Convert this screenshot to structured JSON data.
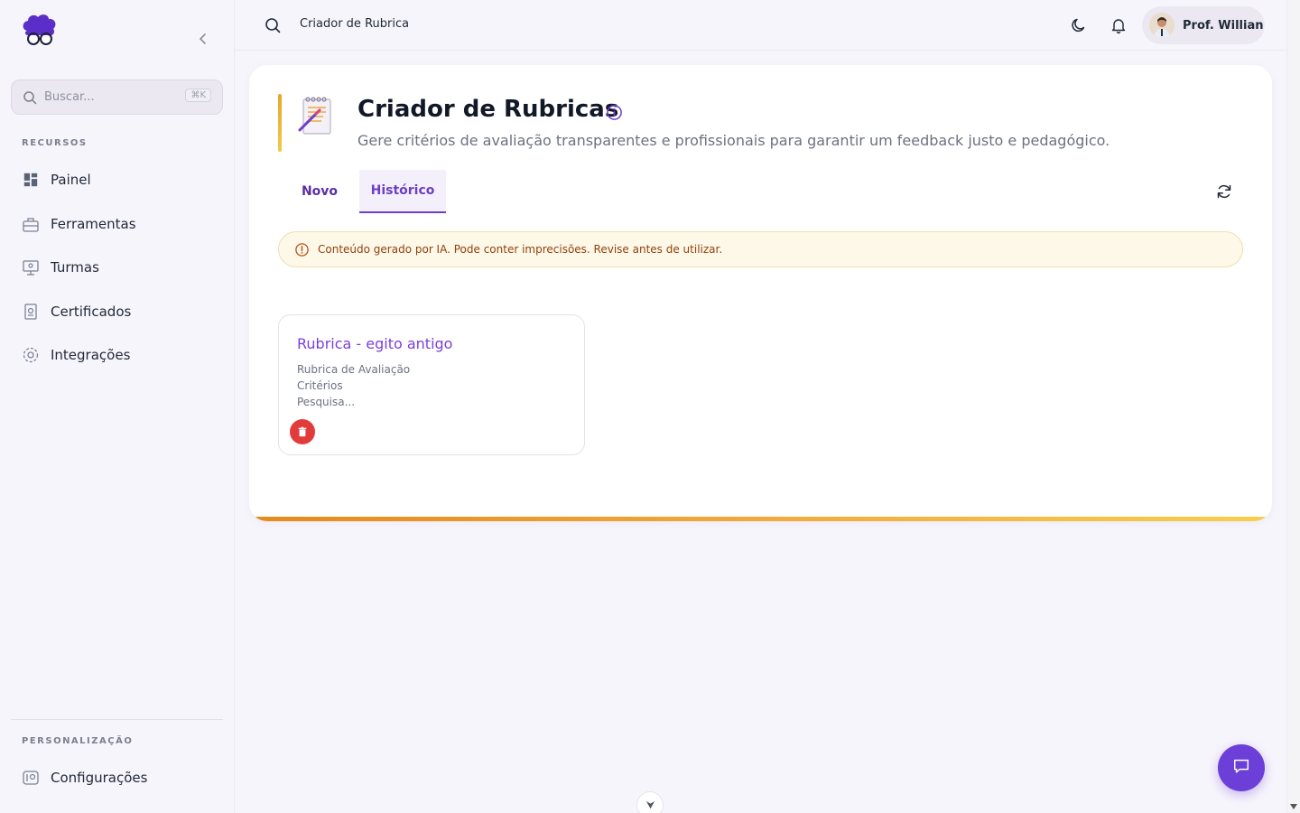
{
  "sidebar": {
    "search_placeholder": "Buscar...",
    "search_shortcut": "⌘K",
    "section_resources": "RECURSOS",
    "items": [
      {
        "label": "Painel",
        "icon": "dashboard-icon"
      },
      {
        "label": "Ferramentas",
        "icon": "toolbox-icon"
      },
      {
        "label": "Turmas",
        "icon": "classroom-icon"
      },
      {
        "label": "Certificados",
        "icon": "certificate-icon"
      },
      {
        "label": "Integrações",
        "icon": "integrations-icon"
      }
    ],
    "section_personalization": "PERSONALIZAÇÃO",
    "settings_label": "Configurações"
  },
  "topbar": {
    "title": "Criador de Rubrica",
    "user_name": "Prof. Willian"
  },
  "page": {
    "title": "Criador de Rubricas",
    "subtitle": "Gere critérios de avaliação transparentes e profissionais para garantir um feedback justo e pedagógico.",
    "tabs": [
      {
        "label": "Novo",
        "active": false
      },
      {
        "label": "Histórico",
        "active": true
      }
    ],
    "warning": "Conteúdo gerado por IA. Pode conter imprecisões. Revise antes de utilizar."
  },
  "history": [
    {
      "title": "Rubrica - egito antigo",
      "lines": [
        "Rubrica de Avaliação",
        "Critérios",
        "Pesquisa..."
      ]
    }
  ],
  "colors": {
    "primary": "#6d3fc7",
    "accent": "#e8a52b",
    "danger": "#e23b3b",
    "warning_text": "#92400e"
  }
}
